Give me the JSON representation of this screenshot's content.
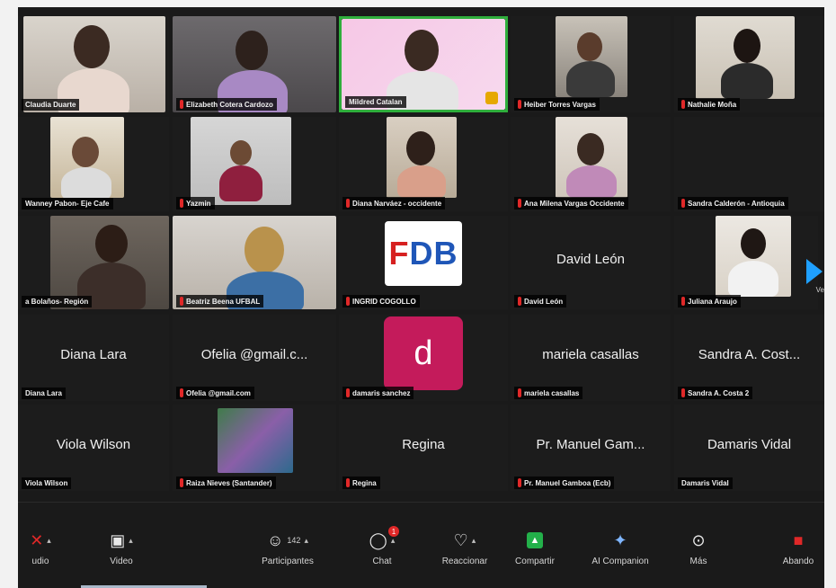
{
  "participants": [
    {
      "name": "Claudia Duarte",
      "muted": false
    },
    {
      "name": "Elizabeth Cotera Cardozo",
      "muted": true
    },
    {
      "name": "Mildred Catalan",
      "muted": false
    },
    {
      "name": "Heiber Torres Vargas",
      "muted": true
    },
    {
      "name": "Nathalie Moña",
      "muted": true
    },
    {
      "name": "Wanney Pabon- Eje Cafe",
      "muted": false
    },
    {
      "name": "Yazmin",
      "muted": true
    },
    {
      "name": "Diana Narváez - occidente",
      "muted": true
    },
    {
      "name": "Ana Milena Vargas Occidente",
      "muted": true
    },
    {
      "name": "Sandra Calderón - Antioquia",
      "muted": true
    },
    {
      "name": "a Bolaños- Región",
      "muted": false
    },
    {
      "name": "Beatriz Beena UFBAL",
      "muted": true
    },
    {
      "name": "INGRID COGOLLO",
      "muted": true
    },
    {
      "name": "David León",
      "muted": true
    },
    {
      "name": "Juliana Araujo",
      "muted": true
    },
    {
      "name": "Diana Lara",
      "muted": false
    },
    {
      "name": "Ofelia @gmail.com",
      "muted": true
    },
    {
      "name": "damaris sanchez",
      "muted": true
    },
    {
      "name": "mariela casallas",
      "muted": true
    },
    {
      "name": "Sandra A. Costa 2",
      "muted": true
    },
    {
      "name": "Viola Wilson",
      "muted": false
    },
    {
      "name": "Raiza Nieves (Santander)",
      "muted": true
    },
    {
      "name": "Regina",
      "muted": true
    },
    {
      "name": "Pr. Manuel Gamboa (Ecb)",
      "muted": true
    },
    {
      "name": "Damaris Vidal",
      "muted": false
    }
  ],
  "display_names": {
    "david_leon": "David León",
    "diana_lara": "Diana Lara",
    "ofelia": "Ofelia @gmail.c...",
    "mariela": "mariela casallas",
    "sandra_costa": "Sandra A. Cost...",
    "viola": "Viola Wilson",
    "regina": "Regina",
    "manuel": "Pr. Manuel Gam...",
    "damaris_vidal": "Damaris Vidal",
    "damaris_avatar_letter": "d",
    "ingrid_logo": "DB",
    "cut_off_label": "Ve"
  },
  "toolbar": {
    "audio": {
      "label": "udio",
      "icon": "mic-muted-icon"
    },
    "video": {
      "label": "Video",
      "icon": "camera-icon"
    },
    "participants": {
      "label": "Participantes",
      "count": "142",
      "icon": "people-icon"
    },
    "chat": {
      "label": "Chat",
      "badge": "1",
      "icon": "chat-icon"
    },
    "react": {
      "label": "Reaccionar",
      "icon": "heart-icon"
    },
    "share": {
      "label": "Compartir",
      "icon": "share-screen-icon"
    },
    "ai": {
      "label": "AI Companion",
      "icon": "sparkle-icon"
    },
    "more": {
      "label": "Más",
      "icon": "more-icon"
    },
    "leave": {
      "label": "Abando",
      "icon": "leave-icon"
    }
  },
  "colors": {
    "active_speaker": "#2fae3c",
    "muted_mic": "#e02828",
    "avatar_d": "#c41b5b",
    "share": "#23b04a"
  }
}
